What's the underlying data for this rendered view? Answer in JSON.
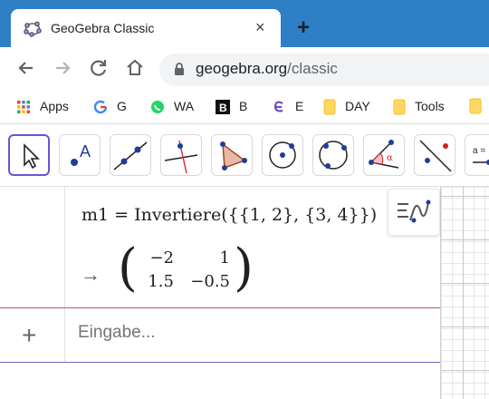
{
  "browser": {
    "tab_title": "GeoGebra Classic",
    "tab_close": "×",
    "new_tab": "+",
    "url_domain": "geogebra.org",
    "url_path": "/classic"
  },
  "bookmarks": [
    {
      "label": "Apps",
      "icon": "apps-grid-icon"
    },
    {
      "label": "G",
      "icon": "google-icon"
    },
    {
      "label": "WA",
      "icon": "whatsapp-icon"
    },
    {
      "label": "B",
      "icon": "b-icon"
    },
    {
      "label": "E",
      "icon": "e-icon"
    },
    {
      "label": "DAY",
      "icon": "folder-icon"
    },
    {
      "label": "Tools",
      "icon": "folder-icon"
    }
  ],
  "geogebra": {
    "tools": [
      "move-tool",
      "point-tool",
      "line-tool",
      "perpendicular-line-tool",
      "polygon-tool",
      "circle-center-point-tool",
      "circle-three-points-tool",
      "angle-tool",
      "reflect-tool",
      "slider-tool"
    ],
    "slider_label": "a =",
    "algebra": {
      "formula": "m1 = Invertiere({{1, 2}, {3, 4}})",
      "arrow": "→",
      "matrix": [
        [
          "−2",
          "1"
        ],
        [
          "1.5",
          "−0.5"
        ]
      ],
      "input_placeholder": "Eingabe...",
      "add_button": "+"
    },
    "colors": {
      "accent": "#6557d2",
      "chrome_blue": "#2e7fc6"
    }
  }
}
